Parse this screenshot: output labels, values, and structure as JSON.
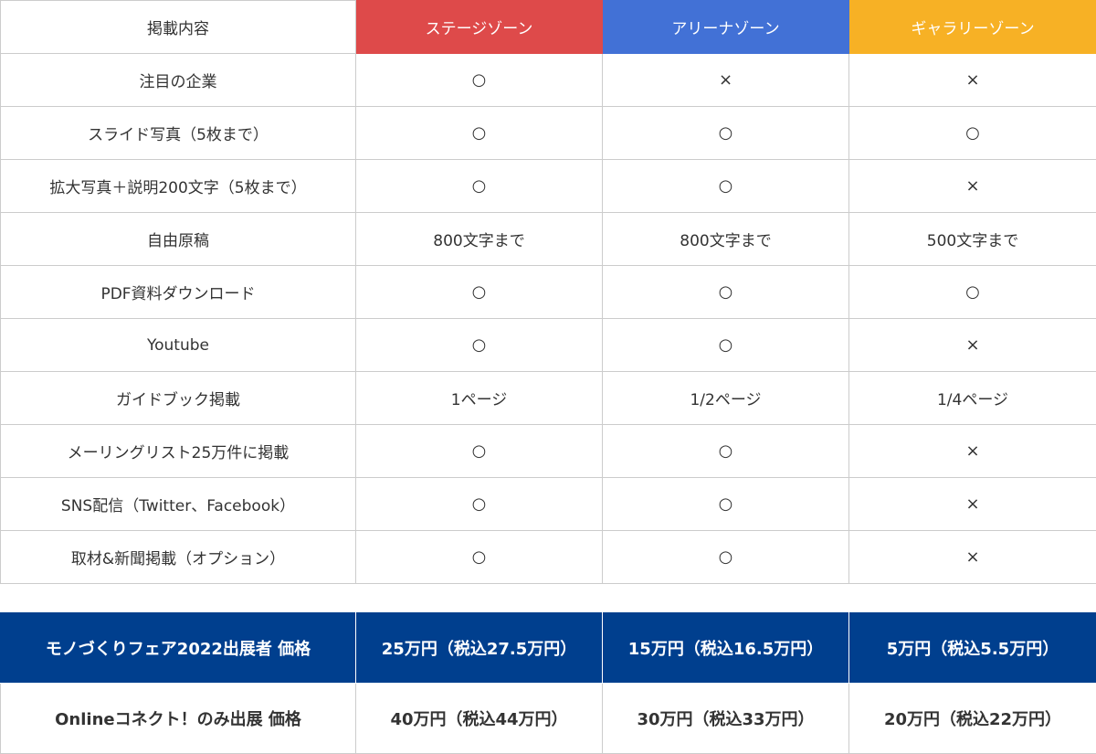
{
  "header": {
    "label": "掲載内容",
    "zones": [
      {
        "name": "ステージゾーン",
        "color": "#de4a4a"
      },
      {
        "name": "アリーナゾーン",
        "color": "#4271d6"
      },
      {
        "name": "ギャラリーゾーン",
        "color": "#f7b125"
      }
    ]
  },
  "rows": [
    {
      "label": "注目の企業",
      "values": [
        "○",
        "×",
        "×"
      ]
    },
    {
      "label": "スライド写真（5枚まで）",
      "values": [
        "○",
        "○",
        "○"
      ]
    },
    {
      "label": "拡大写真＋説明200文字（5枚まで）",
      "values": [
        "○",
        "○",
        "×"
      ]
    },
    {
      "label": "自由原稿",
      "values": [
        "800文字まで",
        "800文字まで",
        "500文字まで"
      ]
    },
    {
      "label": "PDF資料ダウンロード",
      "values": [
        "○",
        "○",
        "○"
      ]
    },
    {
      "label": "Youtube",
      "values": [
        "○",
        "○",
        "×"
      ]
    },
    {
      "label": "ガイドブック掲載",
      "values": [
        "1ページ",
        "1/2ページ",
        "1/4ページ"
      ]
    },
    {
      "label": "メーリングリスト25万件に掲載",
      "values": [
        "○",
        "○",
        "×"
      ]
    },
    {
      "label": "SNS配信（Twitter、Facebook）",
      "values": [
        "○",
        "○",
        "×"
      ]
    },
    {
      "label": "取材&新聞掲載（オプション）",
      "values": [
        "○",
        "○",
        "×"
      ]
    }
  ],
  "pricing": [
    {
      "label": "モノづくりフェア2022出展者 価格",
      "values": [
        "25万円（税込27.5万円）",
        "15万円（税込16.5万円）",
        "5万円（税込5.5万円）"
      ],
      "color": "#003f8e"
    },
    {
      "label": "Onlineコネクト！のみ出展 価格",
      "values": [
        "40万円（税込44万円）",
        "30万円（税込33万円）",
        "20万円（税込22万円）"
      ]
    }
  ]
}
